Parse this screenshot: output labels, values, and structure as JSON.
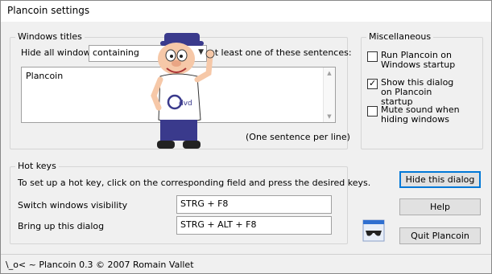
{
  "window": {
    "title": "Plancoin settings"
  },
  "windows_titles": {
    "legend": "Windows titles",
    "hide_all_label": "Hide all windows",
    "match_mode": "containing",
    "suffix_label": "at least one of these sentences:",
    "sentences_value": "Plancoin",
    "hint": "(One sentence per line)"
  },
  "misc": {
    "legend": "Miscellaneous",
    "items": [
      {
        "label": "Run Plancoin on Windows startup",
        "checked": false
      },
      {
        "label": "Show this dialog on Plancoin startup",
        "checked": true
      },
      {
        "label": "Mute sound when hiding windows",
        "checked": false
      }
    ]
  },
  "hotkeys": {
    "legend": "Hot keys",
    "instructions": "To set up a hot key, click on the corresponding field and press the desired keys.",
    "rows": [
      {
        "label": "Switch windows visibility",
        "value": "STRG + F8"
      },
      {
        "label": "Bring up this dialog",
        "value": "STRG + ALT + F8"
      }
    ]
  },
  "buttons": {
    "hide": "Hide this dialog",
    "help": "Help",
    "quit": "Quit Plancoin"
  },
  "mascot": {
    "shirt_text": "dvd"
  },
  "footer": {
    "text": "\\_o< ~ Plancoin 0.3 © 2007 Romain Vallet"
  },
  "colors": {
    "accent": "#0078d7",
    "mascot_shirt": "#ffffff",
    "mascot_hat": "#3a3a8c"
  }
}
